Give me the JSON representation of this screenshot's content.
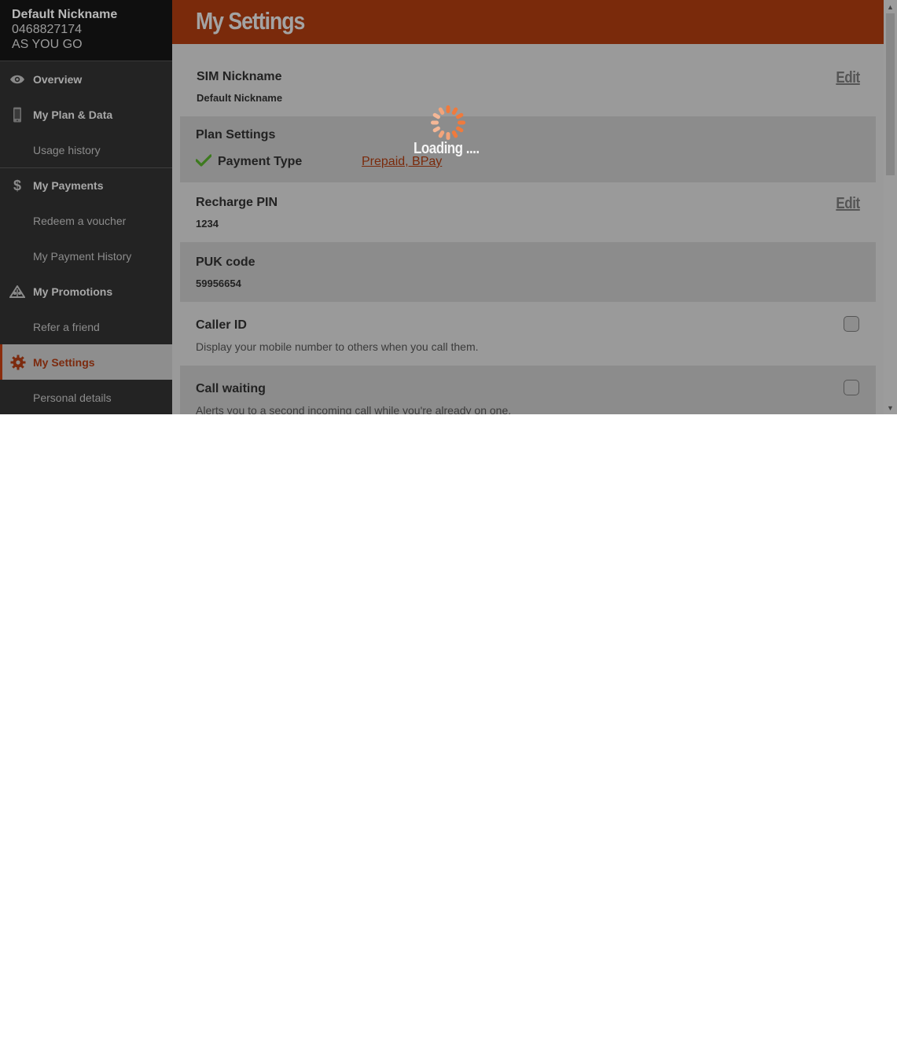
{
  "account": {
    "nickname": "Default Nickname",
    "number": "0468827174",
    "plan": "AS YOU GO"
  },
  "sidebar": {
    "items": [
      {
        "label": "Overview",
        "icon": "eye-icon"
      },
      {
        "label": "My Plan & Data",
        "icon": "phone-icon"
      },
      {
        "label": "Usage history"
      },
      {
        "label": "My Payments",
        "icon": "dollar-icon"
      },
      {
        "label": "Redeem a voucher"
      },
      {
        "label": "My Payment History"
      },
      {
        "label": "My Promotions",
        "icon": "promotions-icon"
      },
      {
        "label": "Refer a friend"
      },
      {
        "label": "My Settings",
        "icon": "gear-icon",
        "active": true
      },
      {
        "label": "Personal details"
      }
    ]
  },
  "page": {
    "title": "My Settings"
  },
  "settings": {
    "sim_nickname": {
      "title": "SIM Nickname",
      "value": "Default Nickname",
      "edit": "Edit"
    },
    "plan_settings": {
      "title": "Plan Settings",
      "payment_type_label": "Payment Type",
      "payment_type_value": "Prepaid, BPay"
    },
    "recharge_pin": {
      "title": "Recharge PIN",
      "value": "1234",
      "edit": "Edit"
    },
    "puk_code": {
      "title": "PUK code",
      "value": "59956654"
    },
    "caller_id": {
      "title": "Caller ID",
      "description": "Display your mobile number to others when you call them.",
      "checked": false
    },
    "call_waiting": {
      "title": "Call waiting",
      "description": "Alerts you to a second incoming call while you're already on one.",
      "checked": false
    }
  },
  "loading": {
    "text": "Loading ...."
  },
  "colors": {
    "brand": "#7a2a0b",
    "sidebar_bg": "#232323",
    "overlay_bg": "#9a9a9a",
    "check_green": "#3d7a1e",
    "spinner": "#f07a3c"
  }
}
